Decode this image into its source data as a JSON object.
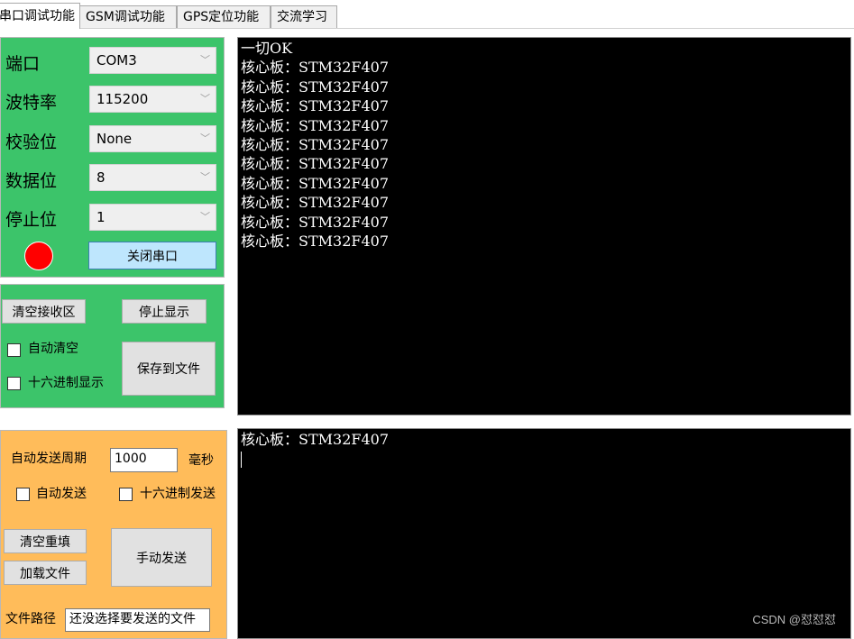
{
  "tabs": [
    {
      "label": "串口调试功能",
      "active": true
    },
    {
      "label": "GSM调试功能",
      "active": false
    },
    {
      "label": "GPS定位功能",
      "active": false
    },
    {
      "label": "交流学习",
      "active": false
    }
  ],
  "serial_settings": {
    "port": {
      "label": "端口",
      "value": "COM3"
    },
    "baud": {
      "label": "波特率",
      "value": "115200"
    },
    "parity": {
      "label": "校验位",
      "value": "None"
    },
    "data_bits": {
      "label": "数据位",
      "value": "8"
    },
    "stop_bits": {
      "label": "停止位",
      "value": "1"
    },
    "indicator_color": "#ff0000",
    "close_port_label": "关闭串口"
  },
  "receive_controls": {
    "clear_label": "清空接收区",
    "stop_label": "停止显示",
    "auto_clear_label": "自动清空",
    "hex_display_label": "十六进制显示",
    "save_label": "保存到文件"
  },
  "send_controls": {
    "period_label": "自动发送周期",
    "period_value": "1000",
    "unit_label": "毫秒",
    "auto_send_label": "自动发送",
    "hex_send_label": "十六进制发送",
    "clear_refill_label": "清空重填",
    "load_file_label": "加载文件",
    "manual_send_label": "手动发送",
    "file_path_label": "文件路径",
    "file_path_value": "还没选择要发送的文件"
  },
  "receive_area": {
    "lines": [
      "一切OK",
      "核心板：STM32F407",
      "核心板：STM32F407",
      "核心板：STM32F407",
      "核心板：STM32F407",
      "核心板：STM32F407",
      "核心板：STM32F407",
      "核心板：STM32F407",
      "核心板：STM32F407",
      "核心板：STM32F407",
      "核心板：STM32F407"
    ]
  },
  "send_area": {
    "lines": [
      "核心板：STM32F407"
    ]
  },
  "watermark": "CSDN @怼怼怼",
  "colors": {
    "settings_panel": "#3cc46a",
    "send_panel": "#ffbc5a",
    "terminal_bg": "#000000"
  }
}
